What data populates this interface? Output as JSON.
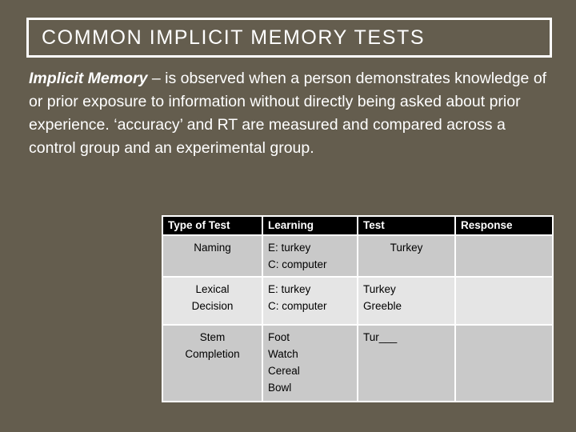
{
  "slide": {
    "title": "COMMON IMPLICIT MEMORY TESTS",
    "background_color": "#645d4e",
    "text_color": "#ffffff"
  },
  "body": {
    "lead_term": "Implicit Memory",
    "definition": " – is observed when a person demonstrates knowledge of or prior exposure to information without directly being asked about prior experience.  ‘accuracy’ and RT are measured and compared across a control group and an experimental group."
  },
  "table": {
    "headers": [
      "Type of Test",
      "Learning",
      "Test",
      "Response"
    ],
    "header_bg": "#000000",
    "header_color": "#ffffff",
    "row_band_dark": "#c9c9c9",
    "row_band_light": "#e5e5e5",
    "rows": [
      {
        "type_of_test": "Naming",
        "learning": "E: turkey\nC: computer",
        "test": "Turkey",
        "response": ""
      },
      {
        "type_of_test": "Lexical\nDecision",
        "learning": "E: turkey\nC: computer",
        "test": "Turkey\nGreeble",
        "response": ""
      },
      {
        "type_of_test": "Stem\nCompletion",
        "learning": "Foot\nWatch\nCereal\nBowl",
        "test": "Tur___",
        "response": ""
      }
    ]
  }
}
